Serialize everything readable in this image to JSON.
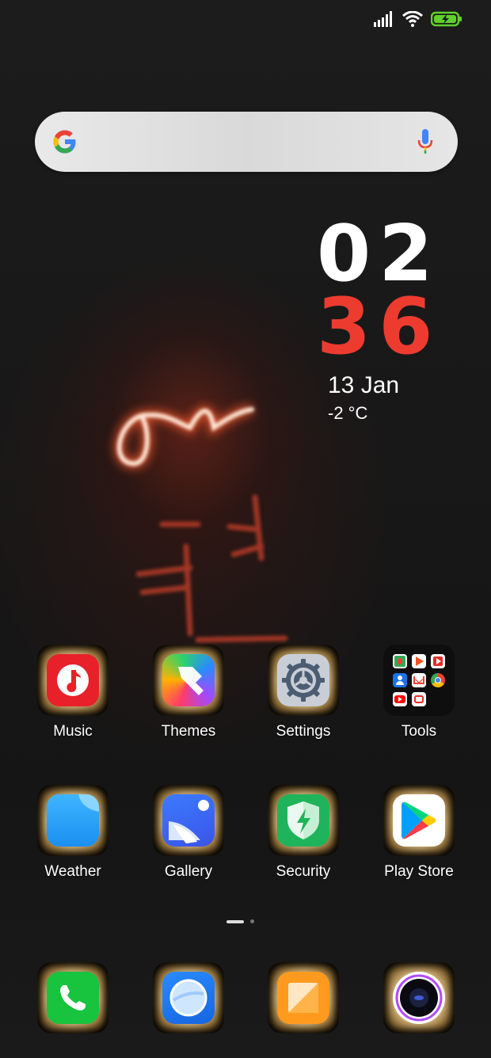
{
  "status_bar": {
    "signal_icon": "signal-bars-icon",
    "wifi_icon": "wifi-icon",
    "battery_icon": "battery-charging-icon",
    "battery_color": "#5fd12b"
  },
  "search": {
    "logo_icon": "google-logo-icon",
    "mic_icon": "microphone-icon"
  },
  "clock": {
    "hour": "02",
    "minute": "36",
    "date": "13 Jan",
    "temperature": "-2 °C",
    "hour_color": "#ffffff",
    "minute_color": "#ee3b30"
  },
  "apps": {
    "row1": [
      {
        "label": "Music",
        "icon": "music-note-icon"
      },
      {
        "label": "Themes",
        "icon": "paintbrush-icon"
      },
      {
        "label": "Settings",
        "icon": "gear-icon"
      },
      {
        "label": "Tools",
        "icon": "folder-icon"
      }
    ],
    "row2": [
      {
        "label": "Weather",
        "icon": "weather-icon"
      },
      {
        "label": "Gallery",
        "icon": "gallery-icon"
      },
      {
        "label": "Security",
        "icon": "shield-bolt-icon"
      },
      {
        "label": "Play Store",
        "icon": "play-store-icon"
      }
    ]
  },
  "dock": [
    {
      "icon": "phone-icon"
    },
    {
      "icon": "browser-icon"
    },
    {
      "icon": "notes-icon"
    },
    {
      "icon": "camera-icon"
    }
  ],
  "page_indicator": {
    "pages": 2,
    "current": 1
  }
}
